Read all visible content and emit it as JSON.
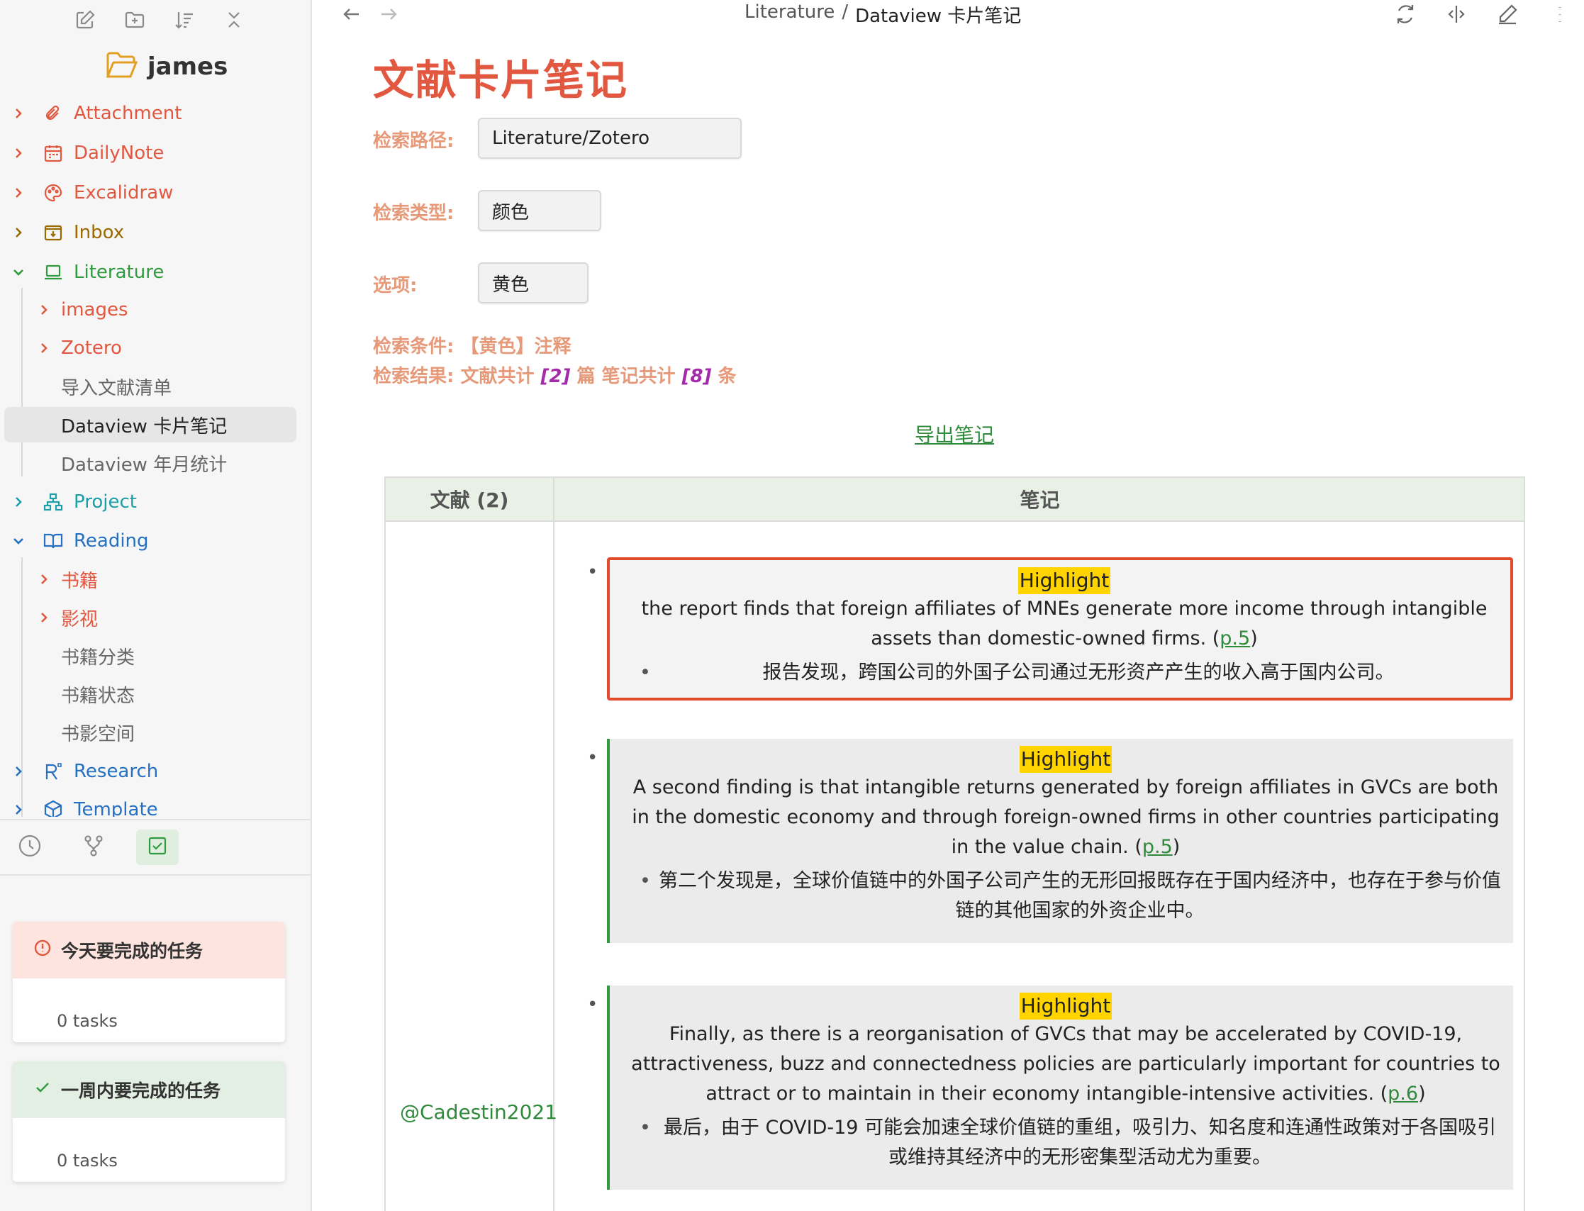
{
  "sidebar": {
    "vault_name": "james",
    "toolbar": [
      "new-note-icon",
      "new-folder-icon",
      "sort-icon",
      "collapse-all-icon"
    ],
    "items": [
      {
        "label": "Attachment",
        "icon": "paperclip-icon",
        "color": "#e2573f",
        "expanded": false
      },
      {
        "label": "DailyNote",
        "icon": "calendar-icon",
        "color": "#e2573f",
        "expanded": false
      },
      {
        "label": "Excalidraw",
        "icon": "palette-icon",
        "color": "#e2573f",
        "expanded": false
      },
      {
        "label": "Inbox",
        "icon": "inbox-icon",
        "color": "#9a6a00",
        "expanded": false
      },
      {
        "label": "Literature",
        "icon": "laptop-icon",
        "color": "#2f9a3e",
        "expanded": true
      },
      {
        "label": "images",
        "color": "#e2573f",
        "expanded": false
      },
      {
        "label": "Zotero",
        "color": "#e2573f",
        "expanded": false
      },
      {
        "label": "导入文献清单",
        "color": "#666666"
      },
      {
        "label": "Dataview 卡片笔记",
        "color": "#222222",
        "active": true
      },
      {
        "label": "Dataview 年月统计",
        "color": "#666666"
      },
      {
        "label": "Project",
        "icon": "sitemap-icon",
        "color": "#1aa0a8",
        "expanded": false
      },
      {
        "label": "Reading",
        "icon": "book-open-icon",
        "color": "#2570c2",
        "expanded": true
      },
      {
        "label": "书籍",
        "color": "#e2573f",
        "expanded": false
      },
      {
        "label": "影视",
        "color": "#e2573f",
        "expanded": false
      },
      {
        "label": "书籍分类",
        "color": "#666666"
      },
      {
        "label": "书籍状态",
        "color": "#666666"
      },
      {
        "label": "书影空间",
        "color": "#666666"
      },
      {
        "label": "Research",
        "icon": "research-icon",
        "color": "#2570c2",
        "expanded": false
      },
      {
        "label": "Template",
        "icon": "cube-icon",
        "color": "#2570c2",
        "expanded": false
      }
    ],
    "tabs": [
      "clock-icon",
      "git-branch-icon",
      "checkbox-icon"
    ],
    "task_cards": [
      {
        "title": "今天要完成的任务",
        "count": "0 tasks",
        "icon": "alert-icon",
        "bg": "#fde4df"
      },
      {
        "title": "一周内要完成的任务",
        "count": "0 tasks",
        "icon": "check-icon",
        "bg": "#e4efe3"
      }
    ]
  },
  "header": {
    "breadcrumb_parent": "Literature",
    "breadcrumb_sep": "/",
    "breadcrumb_current": "Dataview 卡片笔记"
  },
  "doc": {
    "title": "文献卡片笔记",
    "path_label": "检索路径:",
    "path_value": "Literature/Zotero",
    "type_label": "检索类型:",
    "type_value": "颜色",
    "option_label": "选项:",
    "option_value": "黄色",
    "condition_prefix": "检索条件:",
    "condition_value": "【黄色】注释",
    "result_prefix": "检索结果: 文献共计",
    "result_docs": "[2]",
    "result_mid": "篇 笔记共计",
    "result_notes": "[8]",
    "result_suffix": "条",
    "export_label": "导出笔记"
  },
  "table": {
    "col1_header": "文献 (2)",
    "col2_header": "笔记",
    "citation": "@Cadestin2021",
    "notes": [
      {
        "tag": "Highlight",
        "text": "the report finds that foreign affiliates of MNEs generate more income through intangible assets than domestic-owned firms. (",
        "page": "p.5",
        "close": ")",
        "translation": "报告发现，跨国公司的外国子公司通过无形资产产生的收入高于国内公司。"
      },
      {
        "tag": "Highlight",
        "text": "A second finding is that intangible returns generated by foreign affiliates in GVCs are both in the domestic economy and through foreign-owned firms in other countries participating in the value chain. (",
        "page": "p.5",
        "close": ")",
        "translation": "第二个发现是，全球价值链中的外国子公司产生的无形回报既存在于国内经济中，也存在于参与价值链的其他国家的外资企业中。"
      },
      {
        "tag": "Highlight",
        "text": "Finally, as there is a reorganisation of GVCs that may be accelerated by COVID-19, attractiveness, buzz and connectedness policies are particularly important for countries to attract or to maintain in their economy intangible-intensive activities. (",
        "page": "p.6",
        "close": ")",
        "translation": "最后，由于 COVID-19 可能会加速全球价值链的重组，吸引力、知名度和连通性政策对于各国吸引或维持其经济中的无形密集型活动尤为重要。"
      }
    ]
  }
}
